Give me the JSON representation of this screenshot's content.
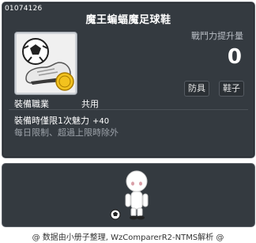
{
  "item": {
    "id": "01074126",
    "name": "魔王蝙蝠魔足球鞋"
  },
  "stats": {
    "power_label": "戰鬥力提升量",
    "power_value": "0"
  },
  "tags": [
    "防具",
    "鞋子"
  ],
  "job": {
    "label": "裝備職業",
    "value": "共用"
  },
  "requirements": {
    "equip_label": "裝備時僅限1次魅力",
    "equip_value": "+40",
    "limit_text": "每日限制、超過上限時除外"
  },
  "footer": {
    "credit": "@ 数据由小册子整理, WzComparerR2-NTMS解析 @"
  },
  "colors": {
    "panel_bg": "#343a40",
    "text_white": "#ffffff",
    "text_gray": "#9ca2a9"
  }
}
